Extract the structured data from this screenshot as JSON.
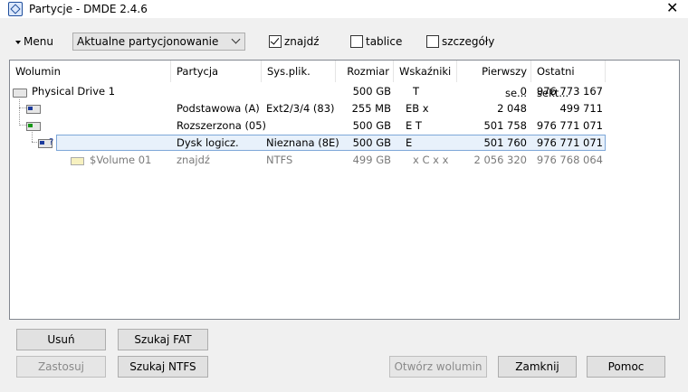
{
  "window": {
    "title": "Partycje - DMDE 2.4.6",
    "close_glyph": "✕"
  },
  "toolbar": {
    "menu_label": "Menu",
    "view_combo_value": "Aktualne partycjonowanie",
    "checkboxes": [
      {
        "label": "znajdź",
        "checked": true
      },
      {
        "label": "tablice",
        "checked": false
      },
      {
        "label": "szczegóły",
        "checked": false
      }
    ]
  },
  "table": {
    "columns": [
      "Wolumin",
      "Partycja",
      "Sys.plik.",
      "Rozmiar",
      "Wskaźniki",
      "Pierwszy se...",
      "Ostatni sekt..."
    ],
    "rows": [
      {
        "volume": "Physical Drive 1",
        "partition": "",
        "fs": "",
        "size": "500 GB",
        "flags": "T",
        "first": "0",
        "last": "976 773 167",
        "icon": "drive-icon"
      },
      {
        "volume": "",
        "partition": "Podstawowa (A)",
        "fs": "Ext2/3/4 (83)",
        "size": "255 MB",
        "flags": "EB x",
        "first": "2 048",
        "last": "499 711",
        "icon": "primary-partition-icon"
      },
      {
        "volume": "",
        "partition": "Rozszerzona  (05)",
        "fs": "",
        "size": "500 GB",
        "flags": "E T",
        "first": "501 758",
        "last": "976 771 071",
        "icon": "extended-partition-icon"
      },
      {
        "volume": "",
        "partition": "Dysk logicz.",
        "fs": "Nieznana (8E)",
        "size": "500 GB",
        "flags": "E",
        "first": "501 760",
        "last": "976 771 071",
        "icon": "logical-partition-icon",
        "marker": "?"
      },
      {
        "volume": "$Volume 01",
        "partition": "znajdź",
        "fs": "NTFS",
        "size": "499 GB",
        "flags": "x C x x",
        "first": "2 056 320",
        "last": "976 768 064",
        "icon": "found-volume-icon"
      }
    ]
  },
  "buttons": {
    "delete": "Usuń",
    "search_fat": "Szukaj FAT",
    "apply": "Zastosuj",
    "search_ntfs": "Szukaj NTFS",
    "open_volume": "Otwórz wolumin",
    "close": "Zamknij",
    "help": "Pomoc"
  }
}
